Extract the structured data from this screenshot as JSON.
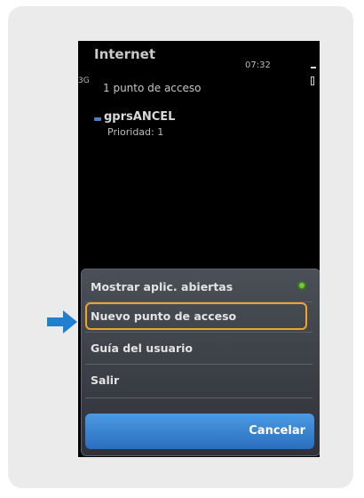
{
  "status": {
    "app_title": "Internet",
    "time": "07:32",
    "network_type": "3G"
  },
  "list": {
    "count_label": "1 punto de acceso",
    "items": [
      {
        "name": "gprsANCEL",
        "priority": "Prioridad: 1"
      }
    ]
  },
  "menu": {
    "items": [
      {
        "label": "Mostrar aplic. abiertas"
      },
      {
        "label": "Nuevo punto de acceso"
      },
      {
        "label": "Guía del usuario"
      },
      {
        "label": "Salir"
      }
    ],
    "cancel_label": "Cancelar"
  },
  "colors": {
    "highlight": "#f0a623",
    "arrow": "#1f7fd0",
    "softkey": "#2f7fd0"
  }
}
